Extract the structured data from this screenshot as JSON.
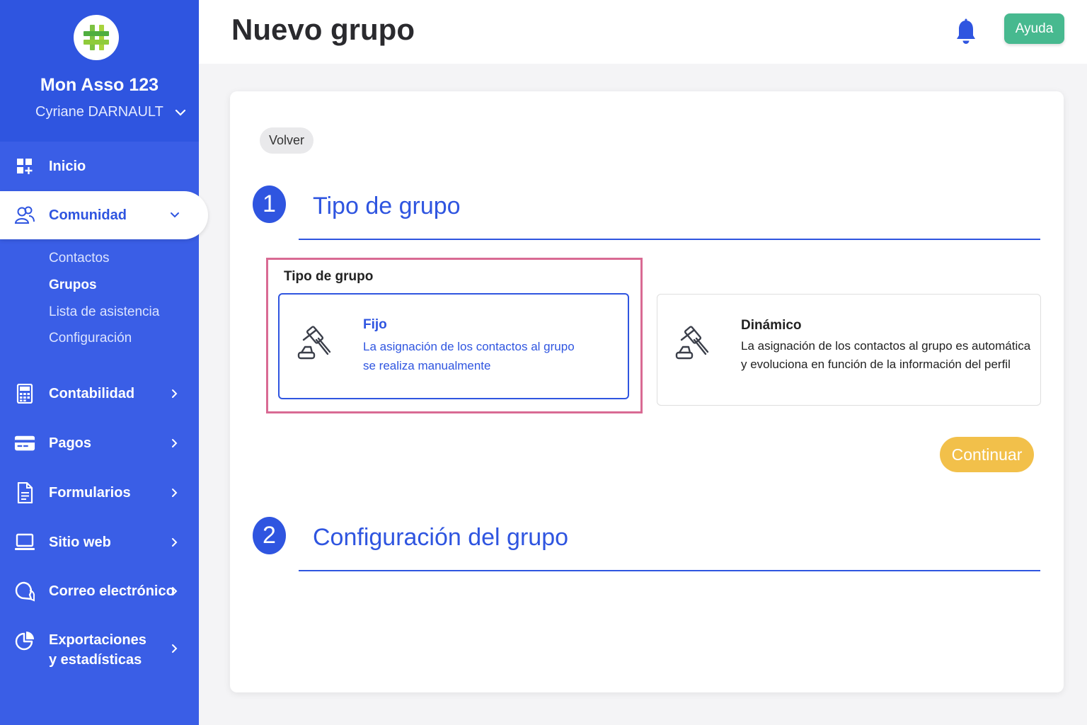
{
  "sidebar": {
    "org_name": "Mon Asso 123",
    "user_name": "Cyriane DARNAULT",
    "nav": {
      "inicio": "Inicio",
      "comunidad": "Comunidad",
      "contabilidad": "Contabilidad",
      "pagos": "Pagos",
      "formularios": "Formularios",
      "sitio_web": "Sitio web",
      "correo": "Correo electrónico",
      "exportaciones_1": "Exportaciones",
      "exportaciones_2": "y estadísticas"
    },
    "submenu": {
      "contactos": "Contactos",
      "grupos": "Grupos",
      "lista": "Lista de asistencia",
      "configuracion": "Configuración"
    }
  },
  "header": {
    "title": "Nuevo grupo",
    "help_label": "Ayuda"
  },
  "form": {
    "back_label": "Volver",
    "step1": {
      "number": "1",
      "title": "Tipo de grupo"
    },
    "step2": {
      "number": "2",
      "title": "Configuración del grupo"
    },
    "field_label": "Tipo de grupo",
    "options": {
      "fixed": {
        "title": "Fijo",
        "desc_1": "La asignación de los contactos al grupo",
        "desc_2": "se realiza manualmente"
      },
      "dynamic": {
        "title": "Dinámico",
        "desc_1": "La asignación de los contactos al grupo es automática",
        "desc_2": "y evoluciona en función de la información del perfil"
      }
    },
    "continue_label": "Continuar"
  },
  "colors": {
    "brand_blue": "#2f55e0",
    "sidebar_blue": "#3a5ee6",
    "help_green": "#47b98f",
    "continue_yellow": "#f2c04a",
    "highlight_pink": "#d96a93"
  },
  "icons": {
    "logo": "hashtag-logo-icon",
    "bell": "bell-icon",
    "option": "gavel-icon"
  }
}
